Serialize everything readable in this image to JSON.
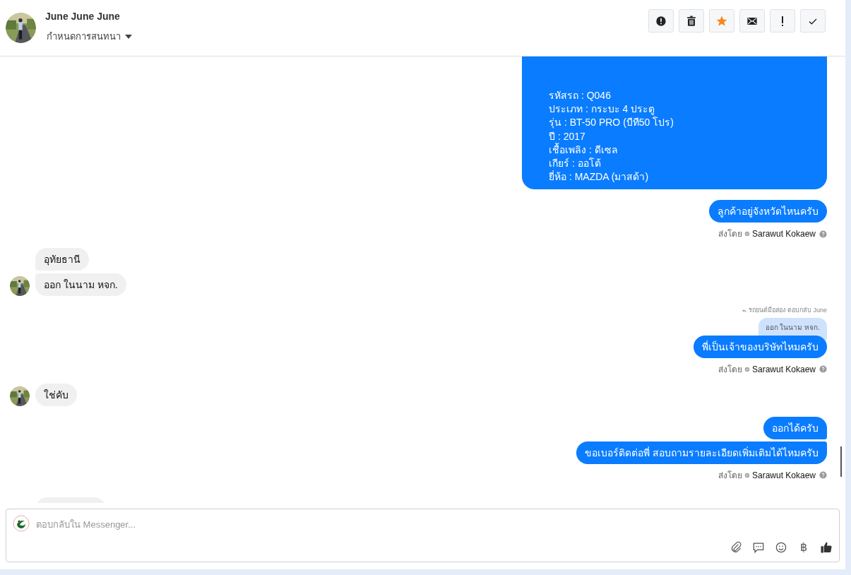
{
  "header": {
    "name": "June June June",
    "menu_label": "กำหนดการสนทนา"
  },
  "toolbar": [
    {
      "kind": "alert"
    },
    {
      "kind": "trash"
    },
    {
      "kind": "star",
      "on": true
    },
    {
      "kind": "mail"
    },
    {
      "kind": "exclaim"
    },
    {
      "kind": "check"
    }
  ],
  "messages": [
    {
      "kind": "outgoing_card",
      "lines": [
        "รหัสรถ : Q046",
        "ประเภท : กระบะ 4 ประตู",
        "รุ่น : BT-50 PRO (บีที50 โปร)",
        "ปี : 2017",
        "เชื้อเพลิง : ดีเซล",
        "เกียร์ : ออโต้",
        "ยี่ห้อ : MAZDA (มาสด้า)"
      ]
    },
    {
      "kind": "outgoing",
      "texts": [
        "ลูกค้าอยู่จังหวัดไหนครับ"
      ]
    },
    {
      "kind": "sent_by",
      "label": "ส่งโดย",
      "name": "Sarawut Kokaew"
    },
    {
      "kind": "incoming",
      "texts": [
        "อุทัยธานี",
        "ออก ในนาม หจก."
      ]
    },
    {
      "kind": "reply",
      "note": "รถยนต์มือสอง ตอบกลับ June",
      "quoted": "ออก ในนาม หจก.",
      "text": "พี่เป็นเจ้าของบริษัทไหมครับ"
    },
    {
      "kind": "sent_by",
      "label": "ส่งโดย",
      "name": "Sarawut Kokaew"
    },
    {
      "kind": "incoming",
      "texts": [
        "ใช่คับ"
      ]
    },
    {
      "kind": "outgoing",
      "texts": [
        "ออกได้ครับ",
        "ขอเบอร์ติดต่อพี่ สอบถามรายละเอียดเพิ่มเติมได้ไหมครับ"
      ]
    },
    {
      "kind": "sent_by",
      "label": "ส่งโดย",
      "name": "Sarawut Kokaew"
    }
  ],
  "composer": {
    "placeholder": "ตอบกลับใน Messenger...",
    "currency_symbol": "฿"
  }
}
